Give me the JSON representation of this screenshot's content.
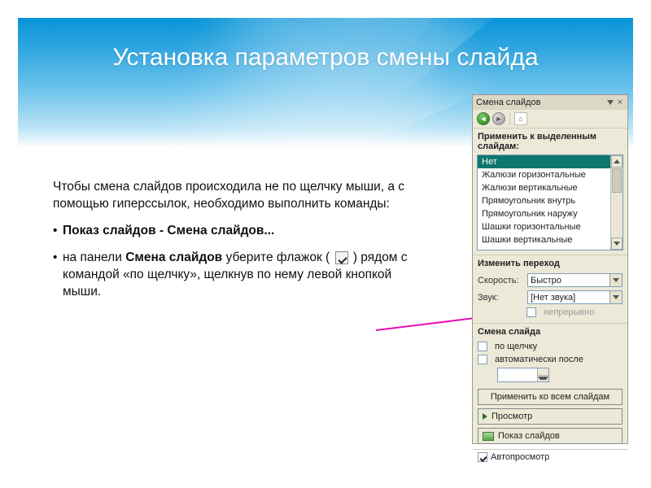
{
  "title": "Установка параметров смены слайда",
  "content": {
    "intro": "Чтобы смена слайдов происходила не по щелчку мыши, а с помощью гиперссылок, необходимо выполнить команды:",
    "bullet1_pre": "Показ слайдов - Смена слайдов...",
    "bullet2_a": "на панели ",
    "bullet2_b": "Смена слайдов",
    "bullet2_c": " уберите флажок ( ",
    "bullet2_d": " ) рядом с командой «по щелчку», щелкнув по нему левой кнопкой мыши."
  },
  "panel": {
    "title": "Смена слайдов",
    "apply_label": "Применить к выделенным слайдам:",
    "transitions": [
      "Нет",
      "Жалюзи горизонтальные",
      "Жалюзи вертикальные",
      "Прямоугольник внутрь",
      "Прямоугольник наружу",
      "Шашки горизонтальные",
      "Шашки вертикальные"
    ],
    "selected_index": 0,
    "change_transition_label": "Изменить переход",
    "speed_label": "Скорость:",
    "speed_value": "Быстро",
    "sound_label": "Звук:",
    "sound_value": "[Нет звука]",
    "loop_label": "непрерывно",
    "advance_label": "Смена слайда",
    "on_click": "по щелчку",
    "auto_after": "автоматически после",
    "apply_all": "Применить ко всем слайдам",
    "preview": "Просмотр",
    "slideshow": "Показ слайдов",
    "autopreview": "Автопросмотр"
  }
}
